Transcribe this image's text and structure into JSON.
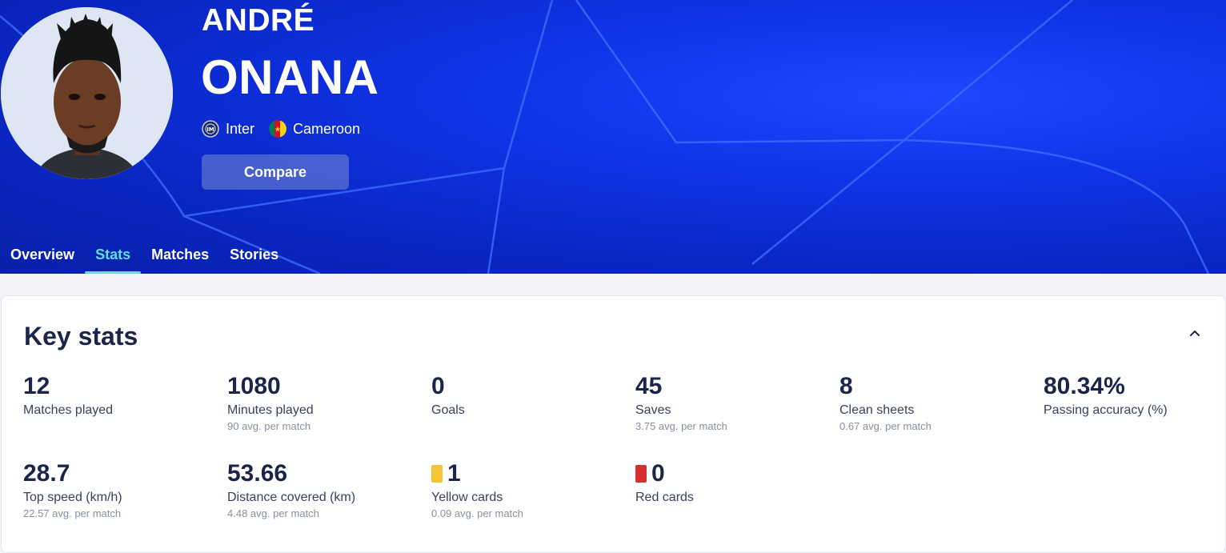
{
  "player": {
    "first_name": "ANDRÉ",
    "last_name": "ONANA",
    "club": "Inter",
    "country": "Cameroon",
    "compare_label": "Compare"
  },
  "tabs": [
    {
      "label": "Overview",
      "active": false
    },
    {
      "label": "Stats",
      "active": true
    },
    {
      "label": "Matches",
      "active": false
    },
    {
      "label": "Stories",
      "active": false
    }
  ],
  "key_stats": {
    "title": "Key stats",
    "items": [
      {
        "value": "12",
        "label": "Matches played",
        "avg": ""
      },
      {
        "value": "1080",
        "label": "Minutes played",
        "avg": "90 avg. per match"
      },
      {
        "value": "0",
        "label": "Goals",
        "avg": ""
      },
      {
        "value": "45",
        "label": "Saves",
        "avg": "3.75 avg. per match"
      },
      {
        "value": "8",
        "label": "Clean sheets",
        "avg": "0.67 avg. per match"
      },
      {
        "value": "80.34%",
        "label": "Passing accuracy (%)",
        "avg": ""
      },
      {
        "value": "28.7",
        "label": "Top speed (km/h)",
        "avg": "22.57 avg. per match"
      },
      {
        "value": "53.66",
        "label": "Distance covered (km)",
        "avg": "4.48 avg. per match"
      },
      {
        "value": "1",
        "label": "Yellow cards",
        "avg": "0.09 avg. per match"
      },
      {
        "value": "0",
        "label": "Red cards",
        "avg": ""
      }
    ]
  },
  "colors": {
    "hero_blue": "#0f33e6",
    "active_tab": "#5be0e8",
    "yellow_card": "#f5c533",
    "red_card": "#d32f2f",
    "text_dark": "#1d2449"
  },
  "icons": {
    "club": "inter-crest-icon",
    "country": "cameroon-flag-icon",
    "collapse": "chevron-up-icon"
  }
}
